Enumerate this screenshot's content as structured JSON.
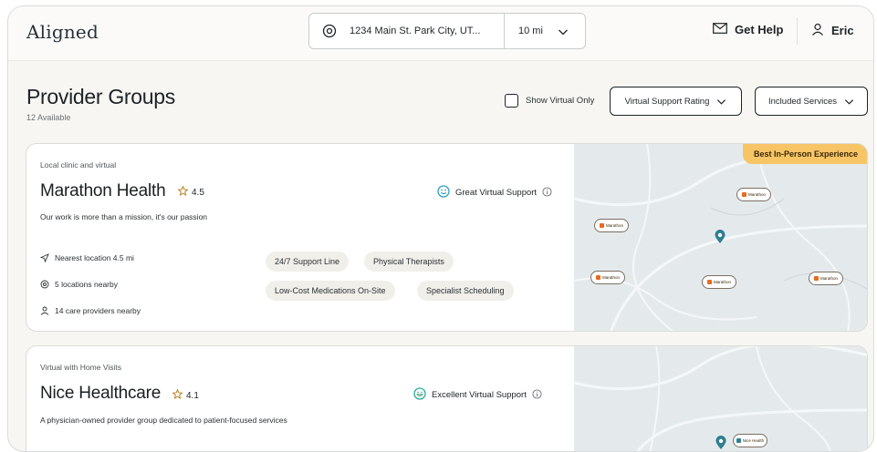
{
  "header": {
    "logo": "Aligned",
    "location": "1234 Main St. Park City, UT...",
    "distance": "10 mi",
    "help_label": "Get Help",
    "user_name": "Eric"
  },
  "page": {
    "title": "Provider Groups",
    "subtitle": "12 Available",
    "virtual_only_label": "Show Virtual Only",
    "filters": [
      {
        "label": "Virtual Support Rating"
      },
      {
        "label": "Included Services"
      }
    ]
  },
  "cards": [
    {
      "type": "Local clinic and virtual",
      "name": "Marathon Health",
      "rating": "4.5",
      "description": "Our work is more than a mission, it's our passion",
      "support_label": "Great Virtual Support",
      "nearest": "Nearest location 4.5 mi",
      "locations": "5 locations nearby",
      "providers": "14 care providers nearby",
      "services": [
        "24/7 Support Line",
        "Physical Therapists",
        "Low-Cost Medications On-Site",
        "Specialist Scheduling"
      ],
      "badge": "Best In-Person Experience",
      "marker_label": "Marathon"
    },
    {
      "type": "Virtual with Home Visits",
      "name": "Nice Healthcare",
      "rating": "4.1",
      "description": "A physician-owned provider group dedicated to patient-focused services",
      "support_label": "Excellent Virtual Support",
      "marker_label": "Nice Health"
    }
  ],
  "colors": {
    "badge": "#f7c566",
    "map_bg": "#e4eaec",
    "pin": "#2e7f8f",
    "accent_green": "#2ea9a0"
  }
}
